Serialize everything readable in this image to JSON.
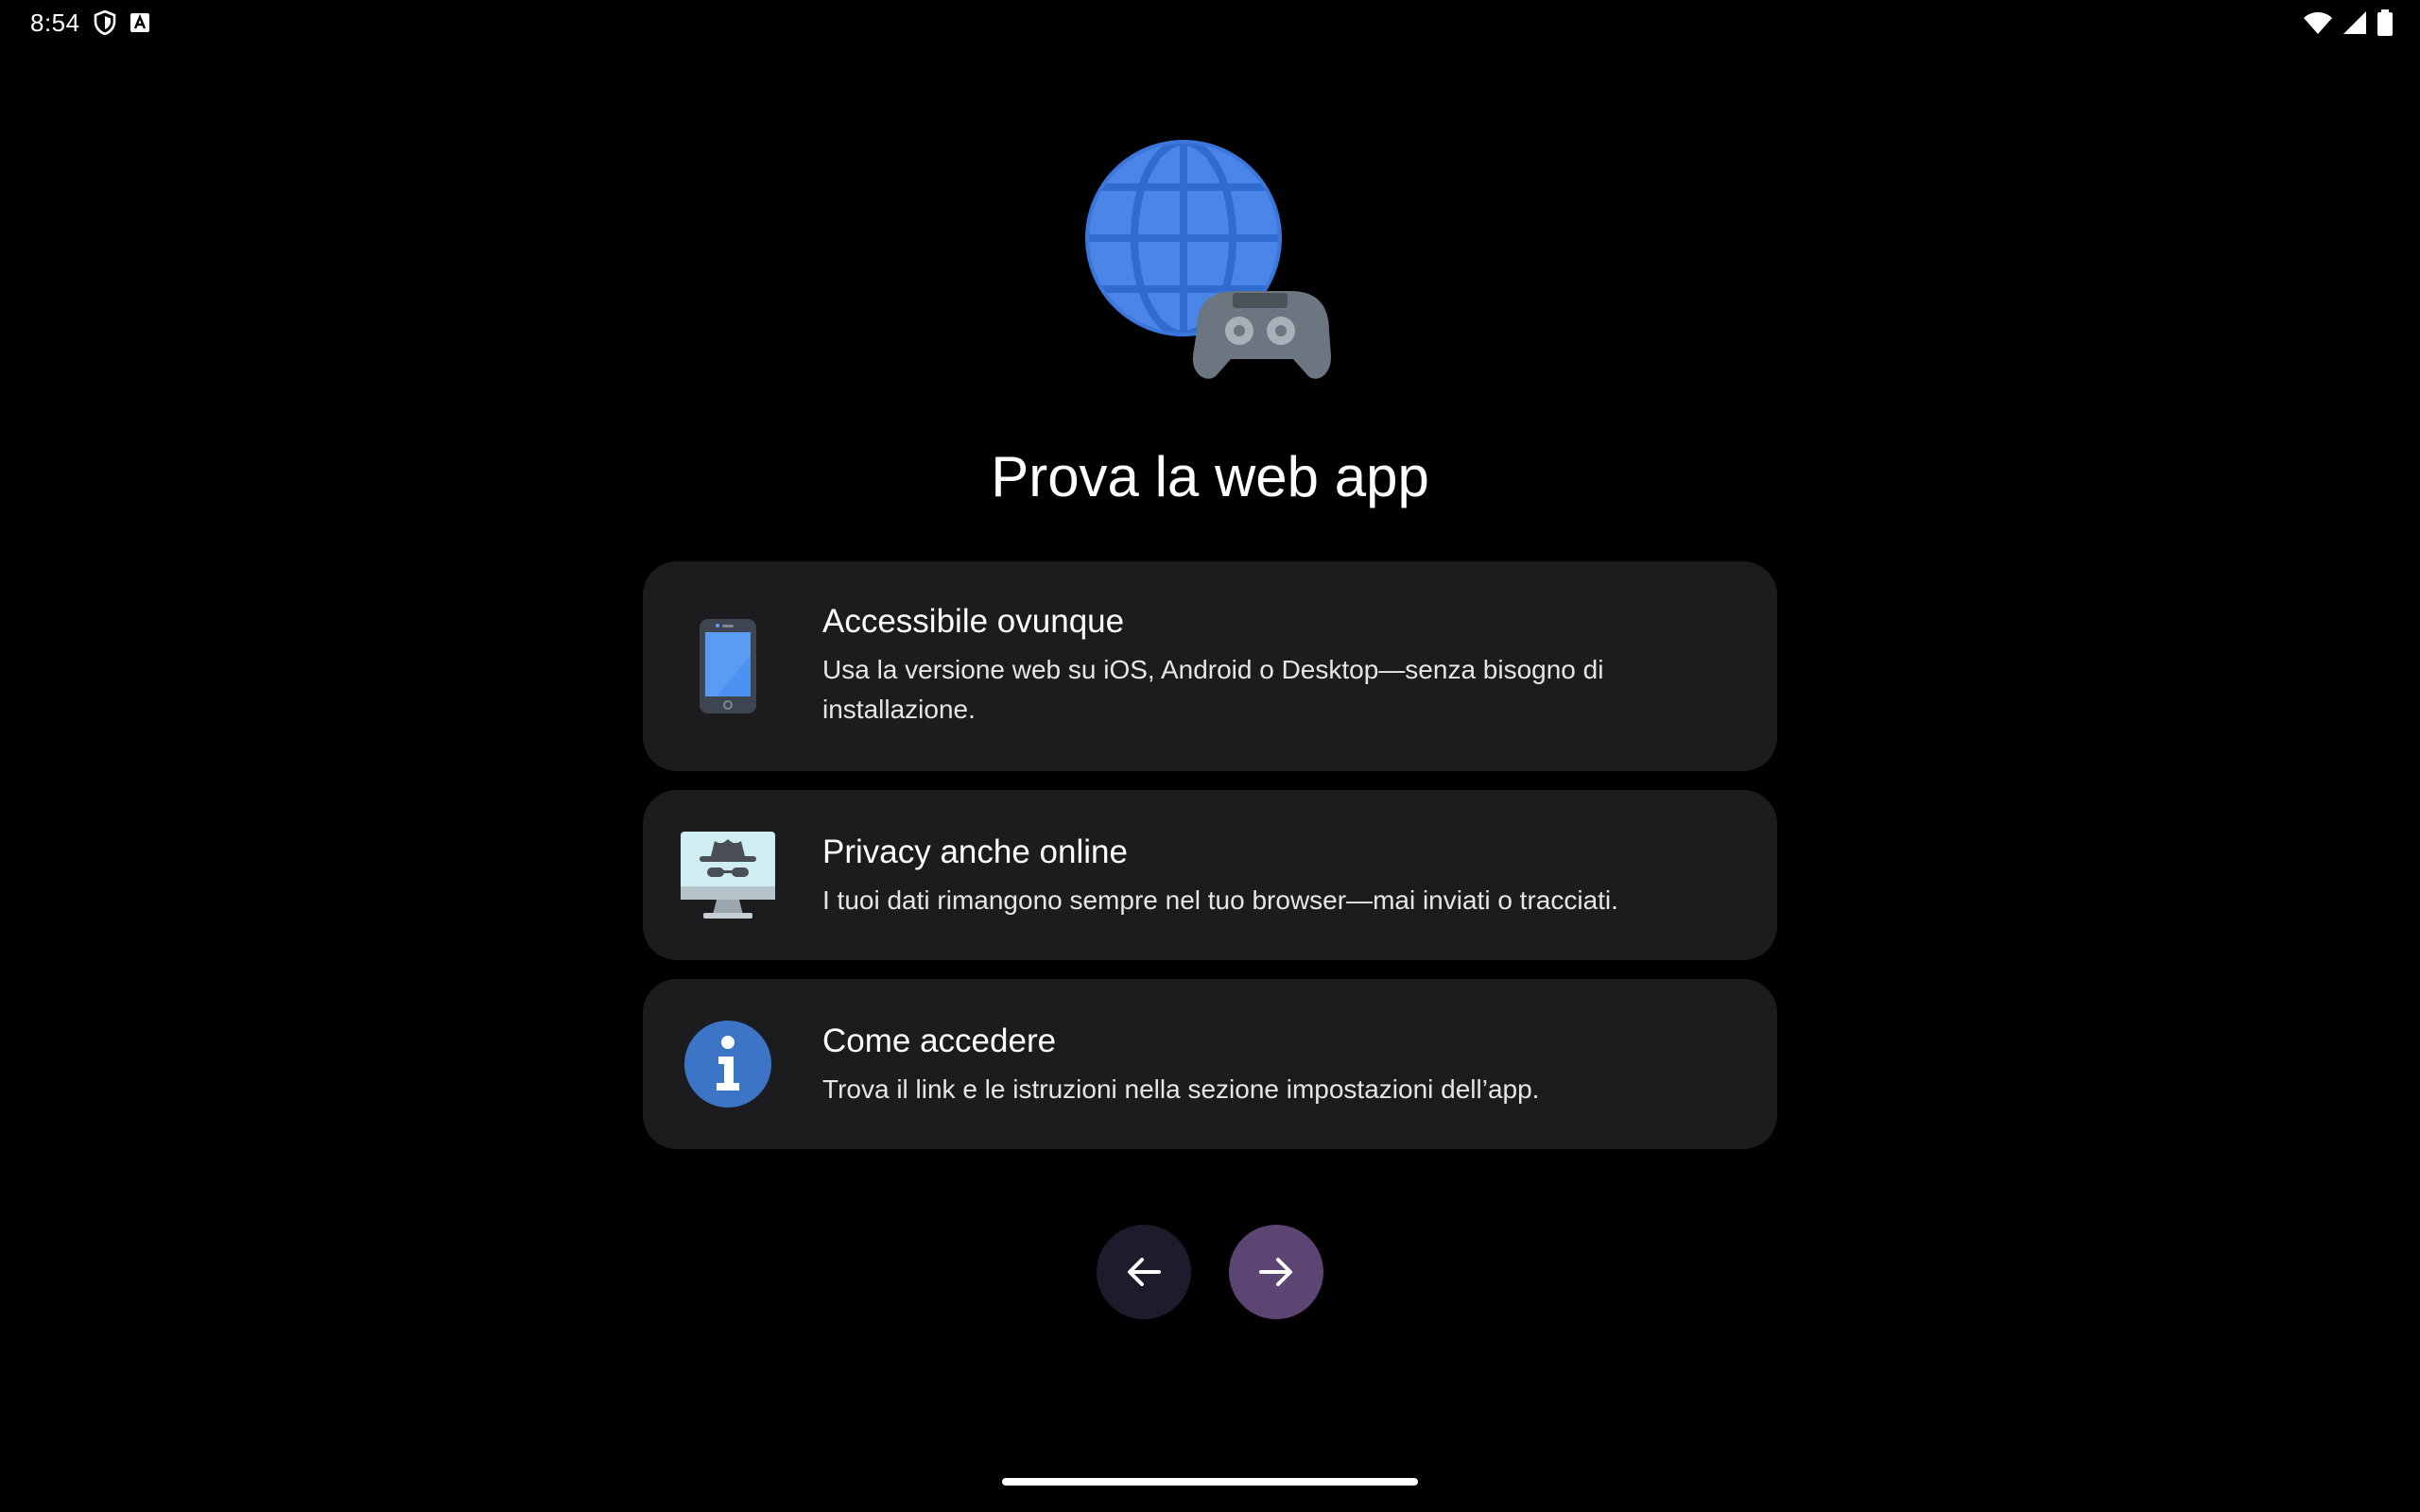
{
  "status_bar": {
    "time": "8:54",
    "left_icons": [
      "shield-icon",
      "keyboard-a-icon"
    ],
    "right_icons": [
      "wifi-icon",
      "signal-icon",
      "battery-icon"
    ]
  },
  "hero": {
    "icons": [
      "globe-icon",
      "gamepad-icon"
    ],
    "colors": {
      "globe": "#4a86e8",
      "gamepad": "#6b7680"
    }
  },
  "title": "Prova la web app",
  "cards": [
    {
      "icon": "smartphone-icon",
      "title": "Accessibile ovunque",
      "description": "Usa la versione web su iOS, Android o Desktop—senza bisogno di installazione."
    },
    {
      "icon": "incognito-monitor-icon",
      "title": "Privacy anche online",
      "description": "I tuoi dati rimangono sempre nel tuo browser—mai inviati o tracciati."
    },
    {
      "icon": "info-icon",
      "title": "Come accedere",
      "description": "Trova il link e le istruzioni nella sezione impostazioni dell’app."
    }
  ],
  "navigation": {
    "back_icon": "arrow-left-icon",
    "next_icon": "arrow-right-icon",
    "colors": {
      "back": "#1f1a2c",
      "next": "#5d4573"
    }
  }
}
